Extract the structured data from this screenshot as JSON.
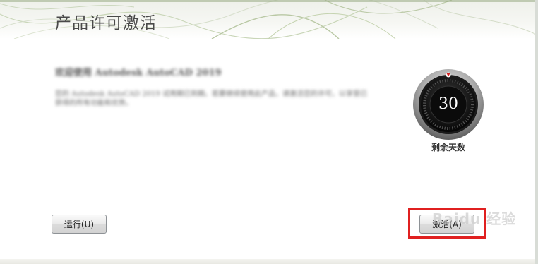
{
  "window": {
    "title": "产品许可激活"
  },
  "welcome": {
    "heading": "欢迎使用 Autodesk AutoCAD 2019",
    "body": "您的 Autodesk AutoCAD 2019 试用期已到期。若要继续使用此产品，请激活您的许可，以享受已获得的所有功能和优势。"
  },
  "trial": {
    "days_remaining": "30",
    "days_label": "剩余天数"
  },
  "buttons": {
    "run": "运行(U)",
    "activate": "激活(A)"
  },
  "watermark": "Baidu 经验",
  "colors": {
    "highlight": "#e02020",
    "dial_marker": "#d42020"
  }
}
